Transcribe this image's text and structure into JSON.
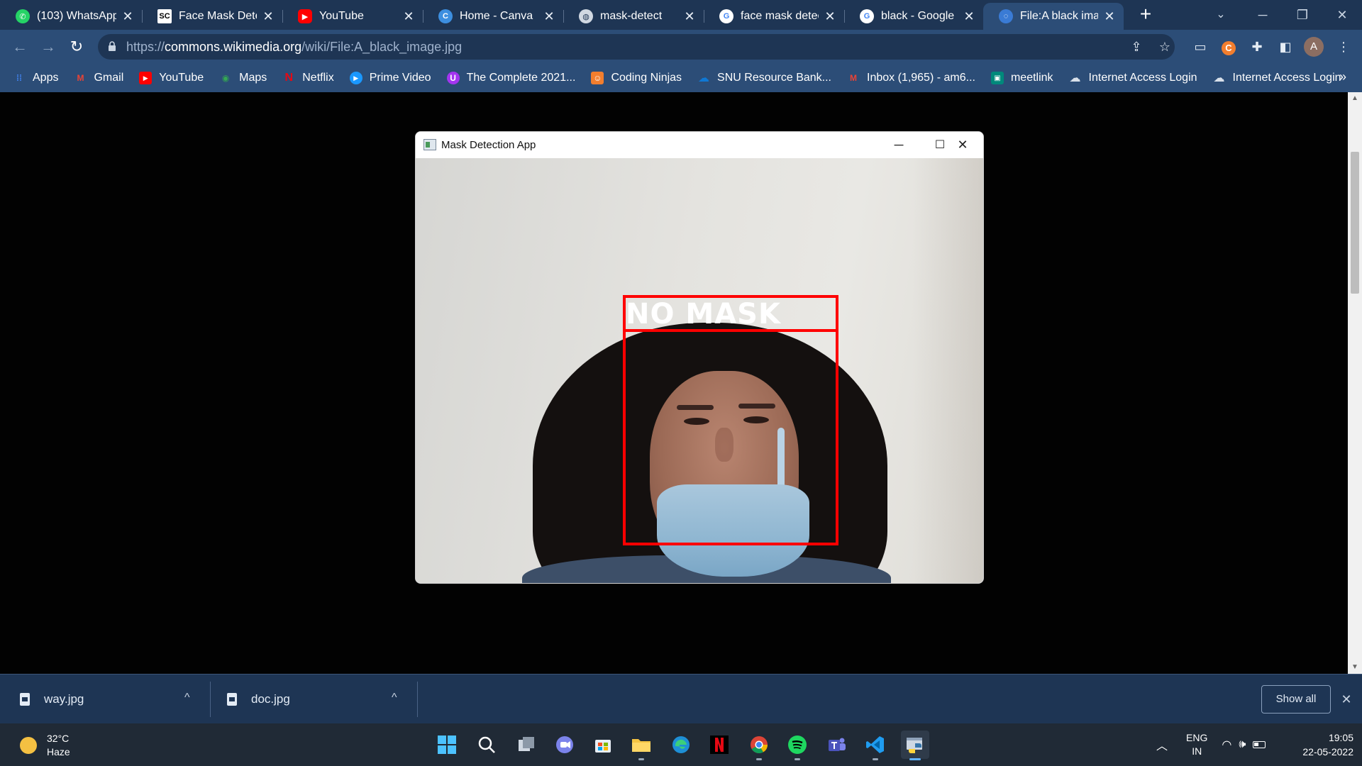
{
  "browser": {
    "tabs": [
      {
        "title": "(103) WhatsApp",
        "icon": "whatsapp-icon",
        "color": "#25d366"
      },
      {
        "title": "Face Mask Detect",
        "icon": "sc-icon",
        "color": "#ffffff"
      },
      {
        "title": "YouTube",
        "icon": "youtube-icon",
        "color": "#ff0000"
      },
      {
        "title": "Home - Canva",
        "icon": "canva-icon",
        "color": "#3d8fe0"
      },
      {
        "title": "mask-detect",
        "icon": "globe-icon",
        "color": "#d0d8e2"
      },
      {
        "title": "face mask detecti",
        "icon": "google-icon",
        "color": "#ffffff"
      },
      {
        "title": "black - Google Se",
        "icon": "google-icon",
        "color": "#ffffff"
      },
      {
        "title": "File:A black image",
        "icon": "wikimedia-icon",
        "color": "#3a7bd5"
      }
    ],
    "active_tab_index": 7,
    "url_prefix": "https://",
    "url_host": "commons.wikimedia.org",
    "url_path": "/wiki/File:A_black_image.jpg",
    "profile_initial": "A"
  },
  "bookmarks": [
    {
      "label": "Apps",
      "icon": "apps-grid-icon",
      "color": "#4285f4"
    },
    {
      "label": "Gmail",
      "icon": "gmail-icon",
      "color": "#ea4335"
    },
    {
      "label": "YouTube",
      "icon": "youtube-icon",
      "color": "#ff0000"
    },
    {
      "label": "Maps",
      "icon": "maps-icon",
      "color": "#34a853"
    },
    {
      "label": "Netflix",
      "icon": "netflix-icon",
      "color": "#e50914"
    },
    {
      "label": "Prime Video",
      "icon": "prime-video-icon",
      "color": "#1a98ff"
    },
    {
      "label": "The Complete 2021...",
      "icon": "udemy-icon",
      "color": "#a435f0"
    },
    {
      "label": "Coding Ninjas",
      "icon": "coding-ninjas-icon",
      "color": "#f27e2e"
    },
    {
      "label": "SNU Resource Bank...",
      "icon": "onedrive-icon",
      "color": "#0f78d4"
    },
    {
      "label": "Inbox (1,965) - am6...",
      "icon": "gmail-icon",
      "color": "#ea4335"
    },
    {
      "label": "meetlink",
      "icon": "meet-icon",
      "color": "#00897b"
    },
    {
      "label": "Internet Access Login",
      "icon": "cloud-icon",
      "color": "#d8e0ea"
    },
    {
      "label": "Internet Access Login",
      "icon": "cloud-icon",
      "color": "#d8e0ea"
    }
  ],
  "app_window": {
    "title": "Mask Detection App",
    "detection_label": "NO MASK",
    "box_color": "#ff0000"
  },
  "downloads": [
    {
      "filename": "way.jpg"
    },
    {
      "filename": "doc.jpg"
    }
  ],
  "downloads_show_all": "Show all",
  "taskbar": {
    "weather_temp": "32°C",
    "weather_desc": "Haze",
    "lang_primary": "ENG",
    "lang_secondary": "IN",
    "time": "19:05",
    "date": "22-05-2022",
    "apps": [
      {
        "name": "start-button",
        "icon": "windows-icon",
        "running": false
      },
      {
        "name": "search",
        "icon": "search-icon",
        "running": false
      },
      {
        "name": "task-view",
        "icon": "task-view-icon",
        "running": false
      },
      {
        "name": "chat",
        "icon": "chat-icon",
        "running": false
      },
      {
        "name": "microsoft-store",
        "icon": "store-icon",
        "running": false
      },
      {
        "name": "file-explorer",
        "icon": "folder-icon",
        "running": true
      },
      {
        "name": "edge",
        "icon": "edge-icon",
        "running": false
      },
      {
        "name": "netflix",
        "icon": "netflix-icon",
        "running": false
      },
      {
        "name": "chrome",
        "icon": "chrome-icon",
        "running": true
      },
      {
        "name": "spotify",
        "icon": "spotify-icon",
        "running": true
      },
      {
        "name": "teams",
        "icon": "teams-icon",
        "running": false
      },
      {
        "name": "vscode",
        "icon": "vscode-icon",
        "running": true
      },
      {
        "name": "python",
        "icon": "python-icon",
        "running": true,
        "focused": true
      }
    ]
  }
}
